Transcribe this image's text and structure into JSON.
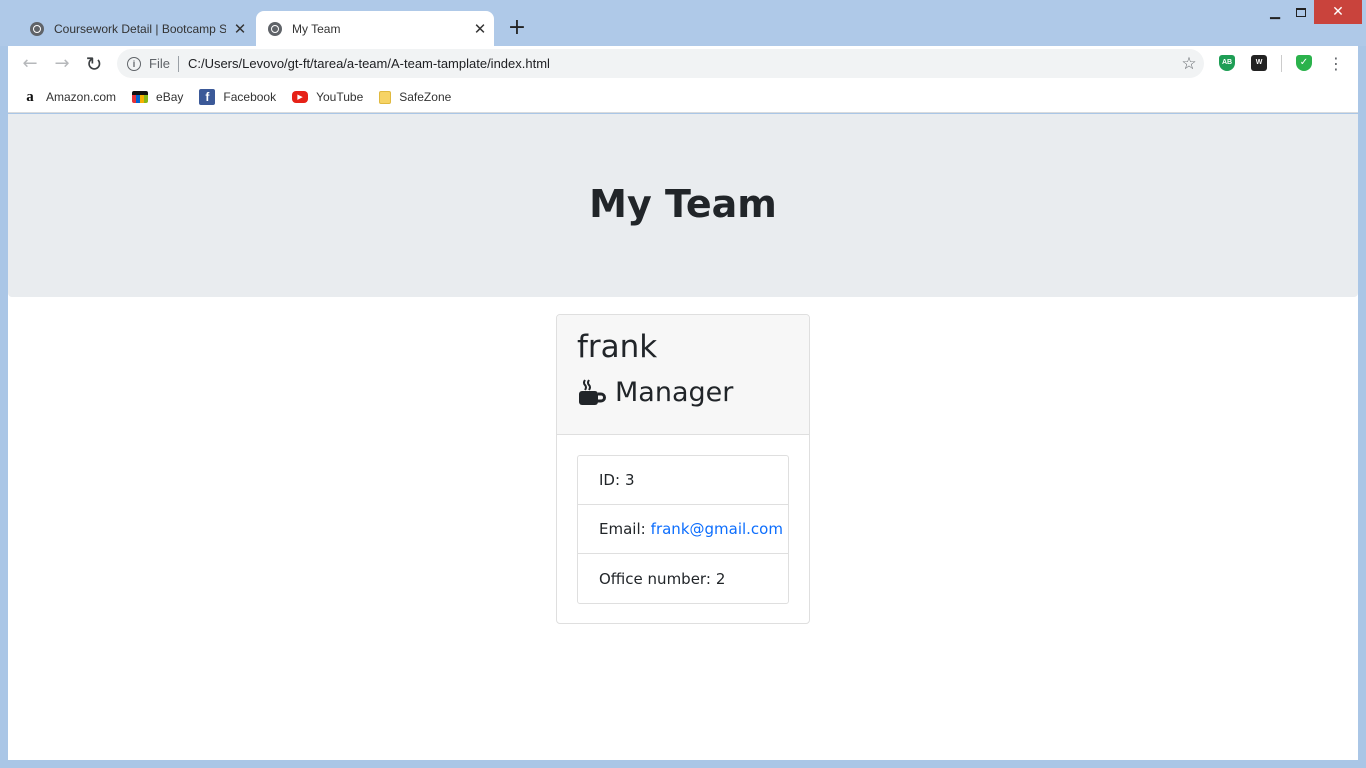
{
  "browser": {
    "tabs": [
      {
        "title": "Coursework Detail | Bootcamp Sp",
        "active": false
      },
      {
        "title": "My Team",
        "active": true
      }
    ],
    "new_tab_glyph": "+",
    "address": {
      "scheme_label": "File",
      "url": "C:/Users/Levovo/gt-ft/tarea/a-team/A-team-tamplate/index.html"
    },
    "extensions": [
      "AB",
      "W"
    ],
    "bookmarks": [
      {
        "label": "Amazon.com",
        "icon": "amazon-icon"
      },
      {
        "label": "eBay",
        "icon": "ebay-icon"
      },
      {
        "label": "Facebook",
        "icon": "facebook-icon"
      },
      {
        "label": "YouTube",
        "icon": "youtube-icon"
      },
      {
        "label": "SafeZone",
        "icon": "folder-icon"
      }
    ]
  },
  "page": {
    "heading": "My Team",
    "employee": {
      "name": "frank",
      "role": "Manager",
      "role_icon": "mug-icon",
      "id_label": "ID:",
      "id_value": "3",
      "email_label": "Email:",
      "email_value": "frank@gmail.com",
      "office_label": "Office number:",
      "office_value": "2"
    }
  },
  "colors": {
    "jumbotron_bg": "#e9ecef",
    "card_header_bg": "#f7f7f7",
    "link": "#0d6efd",
    "close_button": "#c9433c"
  }
}
